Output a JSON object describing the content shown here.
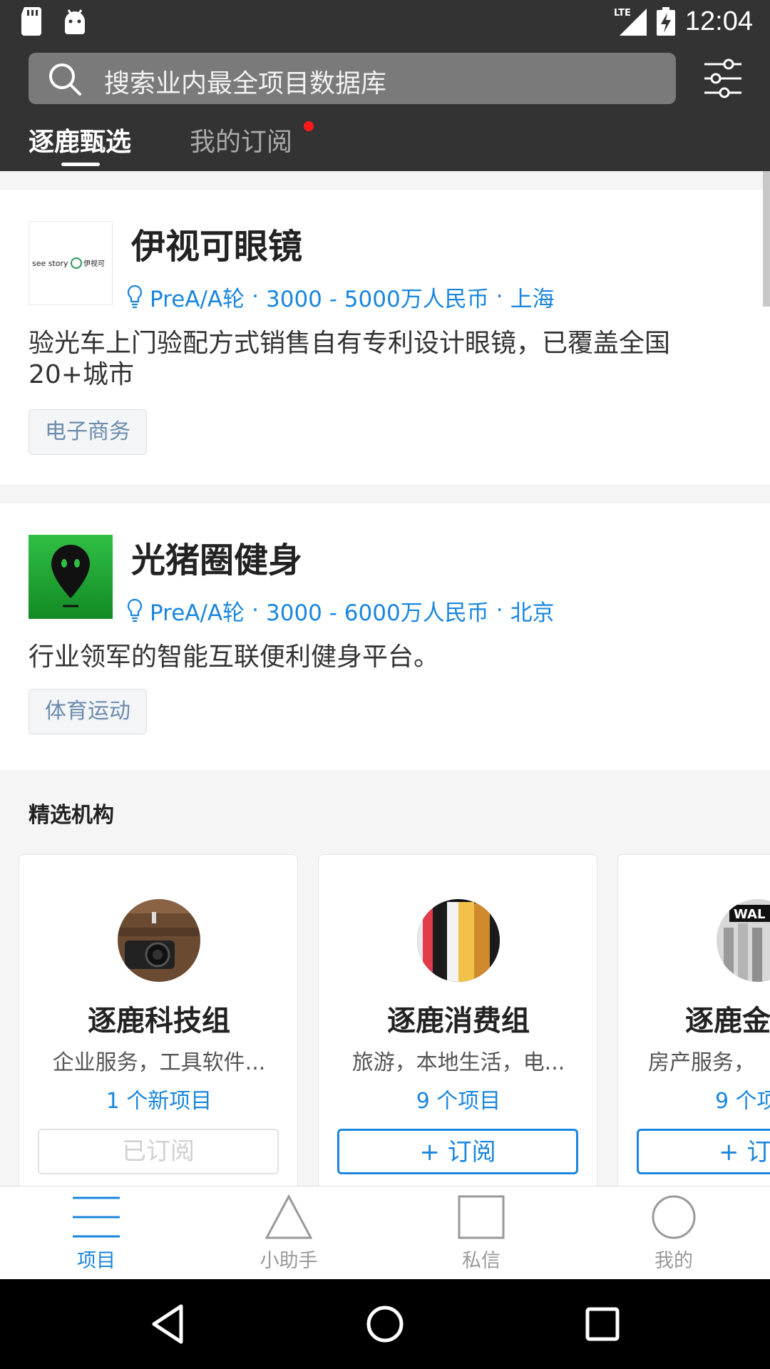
{
  "status_bar": {
    "network": "LTE",
    "time": "12:04"
  },
  "header": {
    "search_placeholder": "搜索业内最全项目数据库",
    "tabs": [
      {
        "label": "逐鹿甄选",
        "active": true
      },
      {
        "label": "我的订阅",
        "active": false,
        "has_dot": true
      }
    ]
  },
  "projects": [
    {
      "name": "伊视可眼镜",
      "logo_text": "see story 伊视可",
      "round": "PreA/A轮",
      "amount": "3000 - 5000万人民币",
      "city": "上海",
      "meta_sep": "·",
      "description": "验光车上门验配方式销售自有专利设计眼镜，已覆盖全国20+城市",
      "tag": "电子商务"
    },
    {
      "name": "光猪圈健身",
      "round": "PreA/A轮",
      "amount": "3000 - 6000万人民币",
      "city": "北京",
      "meta_sep": "·",
      "description": "行业领军的智能互联便利健身平台。",
      "tag": "体育运动"
    }
  ],
  "featured": {
    "title": "精选机构",
    "orgs": [
      {
        "name": "逐鹿科技组",
        "tags": "企业服务，工具软件...",
        "count": "1 个新项目",
        "button": "已订阅",
        "subscribed": true
      },
      {
        "name": "逐鹿消费组",
        "tags": "旅游，本地生活，电...",
        "count": "9 个项目",
        "button": "+ 订阅",
        "subscribed": false
      },
      {
        "name": "逐鹿金",
        "tags": "房产服务，",
        "count": "9 个项",
        "button": "+ 订",
        "subscribed": false
      }
    ]
  },
  "bottom_nav": [
    {
      "label": "项目",
      "icon": "menu-icon",
      "active": true
    },
    {
      "label": "小助手",
      "icon": "triangle-icon",
      "active": false
    },
    {
      "label": "私信",
      "icon": "square-icon",
      "active": false
    },
    {
      "label": "我的",
      "icon": "circle-icon",
      "active": false
    }
  ],
  "colors": {
    "header_bg": "#333333",
    "accent": "#1a86dd",
    "dot": "#ff1a1a"
  }
}
